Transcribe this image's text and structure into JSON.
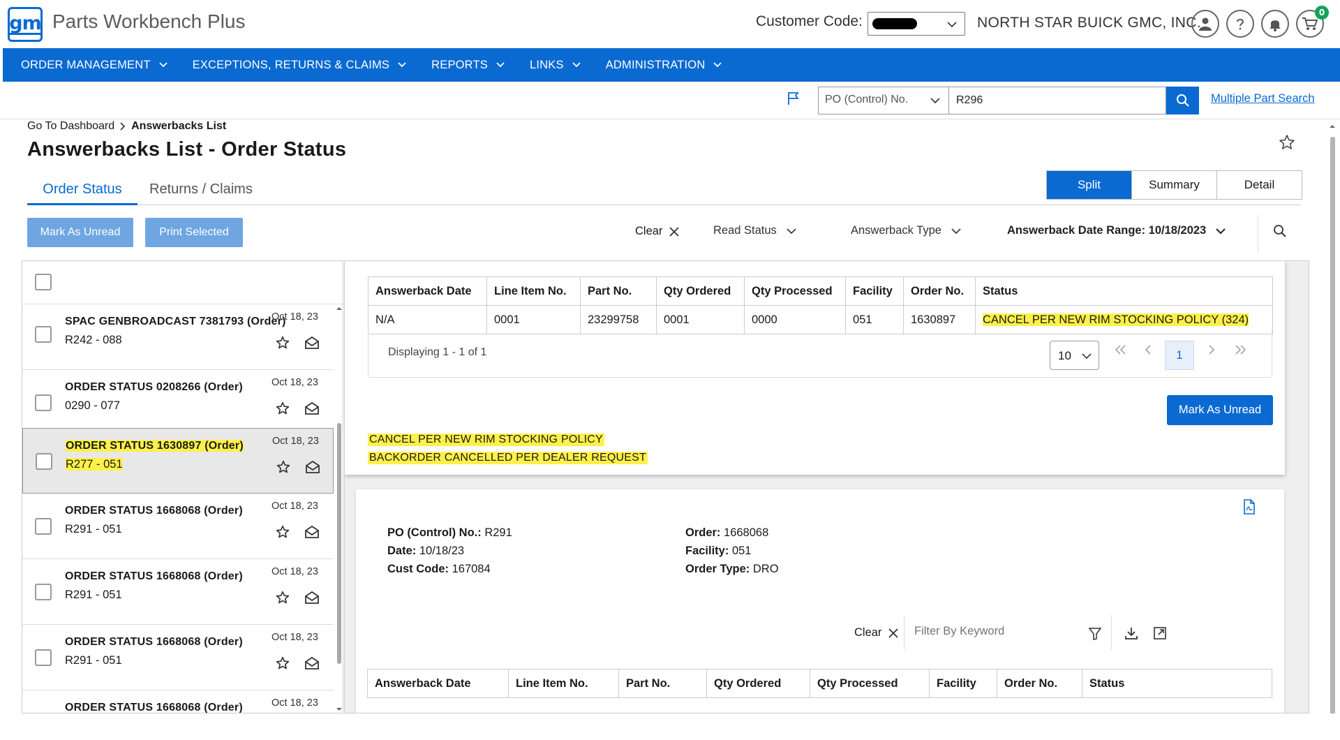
{
  "header": {
    "logo_text": "gm",
    "app_title": "Parts Workbench Plus",
    "customer_code_label": "Customer Code:",
    "dealer_name": "NORTH STAR BUICK GMC, INC.",
    "cart_count": "0"
  },
  "nav": {
    "items": [
      {
        "label": "ORDER MANAGEMENT"
      },
      {
        "label": "EXCEPTIONS, RETURNS & CLAIMS"
      },
      {
        "label": "REPORTS"
      },
      {
        "label": "LINKS"
      },
      {
        "label": "ADMINISTRATION"
      }
    ]
  },
  "search": {
    "type_selected": "PO (Control) No.",
    "value": "R296",
    "multiple_part_search": "Multiple Part Search"
  },
  "breadcrumb": {
    "root": "Go To Dashboard",
    "current": "Answerbacks List"
  },
  "page": {
    "title": "Answerbacks List - Order Status"
  },
  "tabs": [
    {
      "label": "Order Status",
      "active": true
    },
    {
      "label": "Returns / Claims",
      "active": false
    }
  ],
  "views": [
    {
      "label": "Split",
      "active": true
    },
    {
      "label": "Summary",
      "active": false
    },
    {
      "label": "Detail",
      "active": false
    }
  ],
  "toolbar": {
    "mark_unread": "Mark As Unread",
    "print_selected": "Print Selected",
    "clear": "Clear",
    "read_status": "Read Status",
    "answerback_type": "Answerback Type",
    "date_range": "Answerback Date Range: 10/18/2023"
  },
  "list": {
    "items": [
      {
        "title": "SPAC GENBROADCAST 7381793 (Order)",
        "sub": "R242 - 088",
        "date": "Oct 18, 23",
        "selected": false
      },
      {
        "title": "ORDER STATUS 0208266 (Order)",
        "sub": "0290 - 077",
        "date": "Oct 18, 23",
        "selected": false
      },
      {
        "title": "ORDER STATUS 1630897 (Order)",
        "sub": "R277 - 051",
        "date": "Oct 18, 23",
        "selected": true
      },
      {
        "title": "ORDER STATUS 1668068 (Order)",
        "sub": "R291 - 051",
        "date": "Oct 18, 23",
        "selected": false
      },
      {
        "title": "ORDER STATUS 1668068 (Order)",
        "sub": "R291 - 051",
        "date": "Oct 18, 23",
        "selected": false
      },
      {
        "title": "ORDER STATUS 1668068 (Order)",
        "sub": "R291 - 051",
        "date": "Oct 18, 23",
        "selected": false
      },
      {
        "title": "ORDER STATUS 1668068 (Order)",
        "sub": "",
        "date": "Oct 18, 23",
        "selected": false
      }
    ]
  },
  "detail1": {
    "columns": [
      "Answerback Date",
      "Line Item No.",
      "Part No.",
      "Qty Ordered",
      "Qty Processed",
      "Facility",
      "Order No.",
      "Status"
    ],
    "rows": [
      [
        "N/A",
        "0001",
        "23299758",
        "0001",
        "0000",
        "051",
        "1630897",
        "CANCEL PER NEW RIM STOCKING POLICY (324)"
      ]
    ],
    "displaying": "Displaying 1 - 1 of 1",
    "page_size": "10",
    "current_page": "1",
    "mark_unread": "Mark As Unread",
    "notes": [
      "CANCEL PER NEW RIM STOCKING POLICY",
      "BACKORDER CANCELLED PER DEALER REQUEST"
    ]
  },
  "detail2": {
    "po_label": "PO (Control) No.:",
    "po_value": "R291",
    "date_label": "Date:",
    "date_value": "10/18/23",
    "cust_label": "Cust Code:",
    "cust_value": "167084",
    "order_label": "Order:",
    "order_value": "1668068",
    "facility_label": "Facility:",
    "facility_value": "051",
    "type_label": "Order Type:",
    "type_value": "DRO",
    "clear": "Clear",
    "filter_placeholder": "Filter By Keyword",
    "columns": [
      "Answerback Date",
      "Line Item No.",
      "Part No.",
      "Qty Ordered",
      "Qty Processed",
      "Facility",
      "Order No.",
      "Status"
    ]
  },
  "colors": {
    "primary": "#0a6ad1",
    "highlight": "#fff14a",
    "badge": "#13a35a"
  }
}
